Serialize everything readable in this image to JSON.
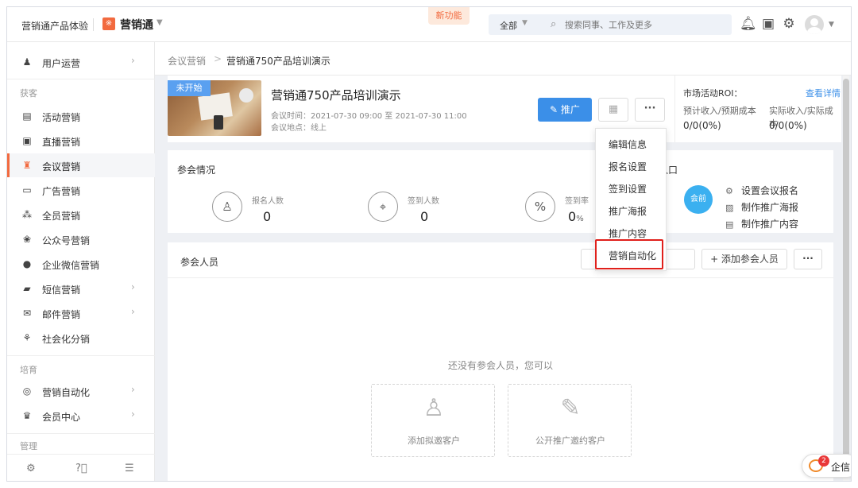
{
  "app": {
    "brand_sub": "营销通产品体验",
    "brand_name": "营销通",
    "brand_logo_glyph": "※",
    "new_feature": "新功能",
    "accent_color": "#f26a3f",
    "primary_color": "#3b8fe8"
  },
  "search": {
    "scope": "全部",
    "placeholder": "搜索同事、工作及更多"
  },
  "sidebar": {
    "items": [
      {
        "label": "用户运营",
        "icon": "user-ops-icon",
        "glyph": "♟",
        "chevron": "›"
      },
      {
        "label": "活动营销",
        "icon": "activity-icon",
        "glyph": "▤"
      },
      {
        "label": "直播营销",
        "icon": "live-icon",
        "glyph": "▣"
      },
      {
        "label": "会议营销",
        "icon": "meeting-icon",
        "glyph": "♜"
      },
      {
        "label": "广告营销",
        "icon": "ad-icon",
        "glyph": "▭"
      },
      {
        "label": "全员营销",
        "icon": "staff-icon",
        "glyph": "⁂"
      },
      {
        "label": "公众号营销",
        "icon": "wechat-icon",
        "glyph": "❀"
      },
      {
        "label": "企业微信营销",
        "icon": "wecom-icon",
        "glyph": "●"
      },
      {
        "label": "短信营销",
        "icon": "sms-icon",
        "glyph": "▰",
        "chevron": "›"
      },
      {
        "label": "邮件营销",
        "icon": "mail-icon",
        "glyph": "✉",
        "chevron": "›"
      },
      {
        "label": "社会化分销",
        "icon": "distribution-icon",
        "glyph": "⚘"
      },
      {
        "label": "营销自动化",
        "icon": "automation-icon",
        "glyph": "◎",
        "chevron": "›"
      },
      {
        "label": "会员中心",
        "icon": "member-icon",
        "glyph": "♛",
        "chevron": "›"
      }
    ],
    "groups": {
      "acquire": "获客",
      "nurture": "培育",
      "manage": "管理"
    }
  },
  "breadcrumb": {
    "parent": "会议营销",
    "separator": ">",
    "current": "营销通750产品培训演示"
  },
  "meeting": {
    "status": "未开始",
    "title": "营销通750产品培训演示",
    "time": "会议时间：2021-07-30 09:00 至 2021-07-30 11:00",
    "location": "会议地点：线上",
    "promote_label": "推广",
    "qr_glyph": "▦",
    "more_glyph": "···"
  },
  "roi": {
    "title": "市场活动ROI：",
    "link": "查看详情",
    "label1": "预计收入/预期成本",
    "label2": "实际收入/实际成本",
    "value1": "0/0(0%)",
    "value2": "0/0(0%)"
  },
  "stats": {
    "title": "参会情况",
    "items": [
      {
        "label": "报名人数",
        "value": "0",
        "glyph": "♙"
      },
      {
        "label": "签到人数",
        "value": "0",
        "glyph": "⌖"
      },
      {
        "label": "签到率",
        "value": "0",
        "unit": "%",
        "glyph": "%"
      }
    ]
  },
  "entry": {
    "title": "入口",
    "circle": "会前",
    "links": [
      {
        "label": "设置会议报名",
        "glyph": "⚙"
      },
      {
        "label": "制作推广海报",
        "glyph": "▨"
      },
      {
        "label": "制作推广内容",
        "glyph": "▤"
      }
    ]
  },
  "attendees": {
    "title": "参会人员",
    "add_label": "+  添加参会人员",
    "more_glyph": "···",
    "empty_text": "还没有参会人员，您可以",
    "actions": [
      {
        "label": "添加拟邀客户",
        "glyph": "♙"
      },
      {
        "label": "公开推广邀约客户",
        "glyph": "✎"
      }
    ]
  },
  "dropdown": {
    "items": [
      "编辑信息",
      "报名设置",
      "签到设置",
      "推广海报",
      "推广内容",
      "营销自动化"
    ],
    "highlight_color": "#e0201b"
  },
  "chat": {
    "badge": "2",
    "label": "企信"
  }
}
